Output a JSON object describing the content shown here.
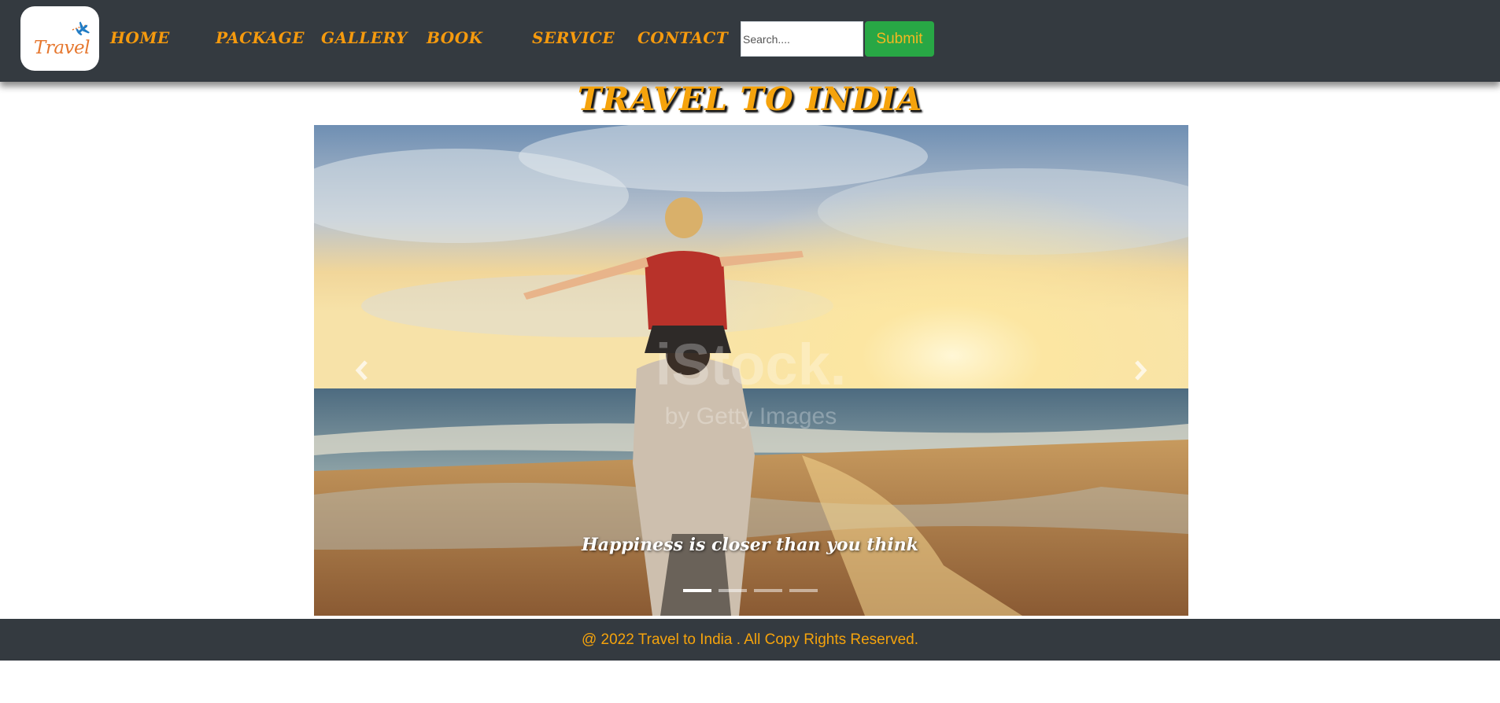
{
  "nav": {
    "logo_text": "Travel",
    "links": [
      {
        "label": "HOME"
      },
      {
        "label": "PACKAGE"
      },
      {
        "label": "GALLERY"
      },
      {
        "label": "BOOK"
      },
      {
        "label": "SERVICE"
      },
      {
        "label": "CONTACT"
      }
    ],
    "search_placeholder": "Search....",
    "submit_label": "Submit"
  },
  "page": {
    "title": "TRAVEL TO INDIA"
  },
  "carousel": {
    "caption": "Happiness is closer than you think",
    "watermark": "iStock. by Getty Images",
    "slide_count": 4,
    "active_slide": 1
  },
  "footer": {
    "text": "@ 2022 Travel to India . All Copy Rights Reserved."
  },
  "colors": {
    "navbar_bg": "#343a40",
    "accent_orange": "#f5a30c",
    "submit_green": "#28a745"
  },
  "icons": [
    "plane-icon",
    "chevron-left-icon",
    "chevron-right-icon"
  ]
}
